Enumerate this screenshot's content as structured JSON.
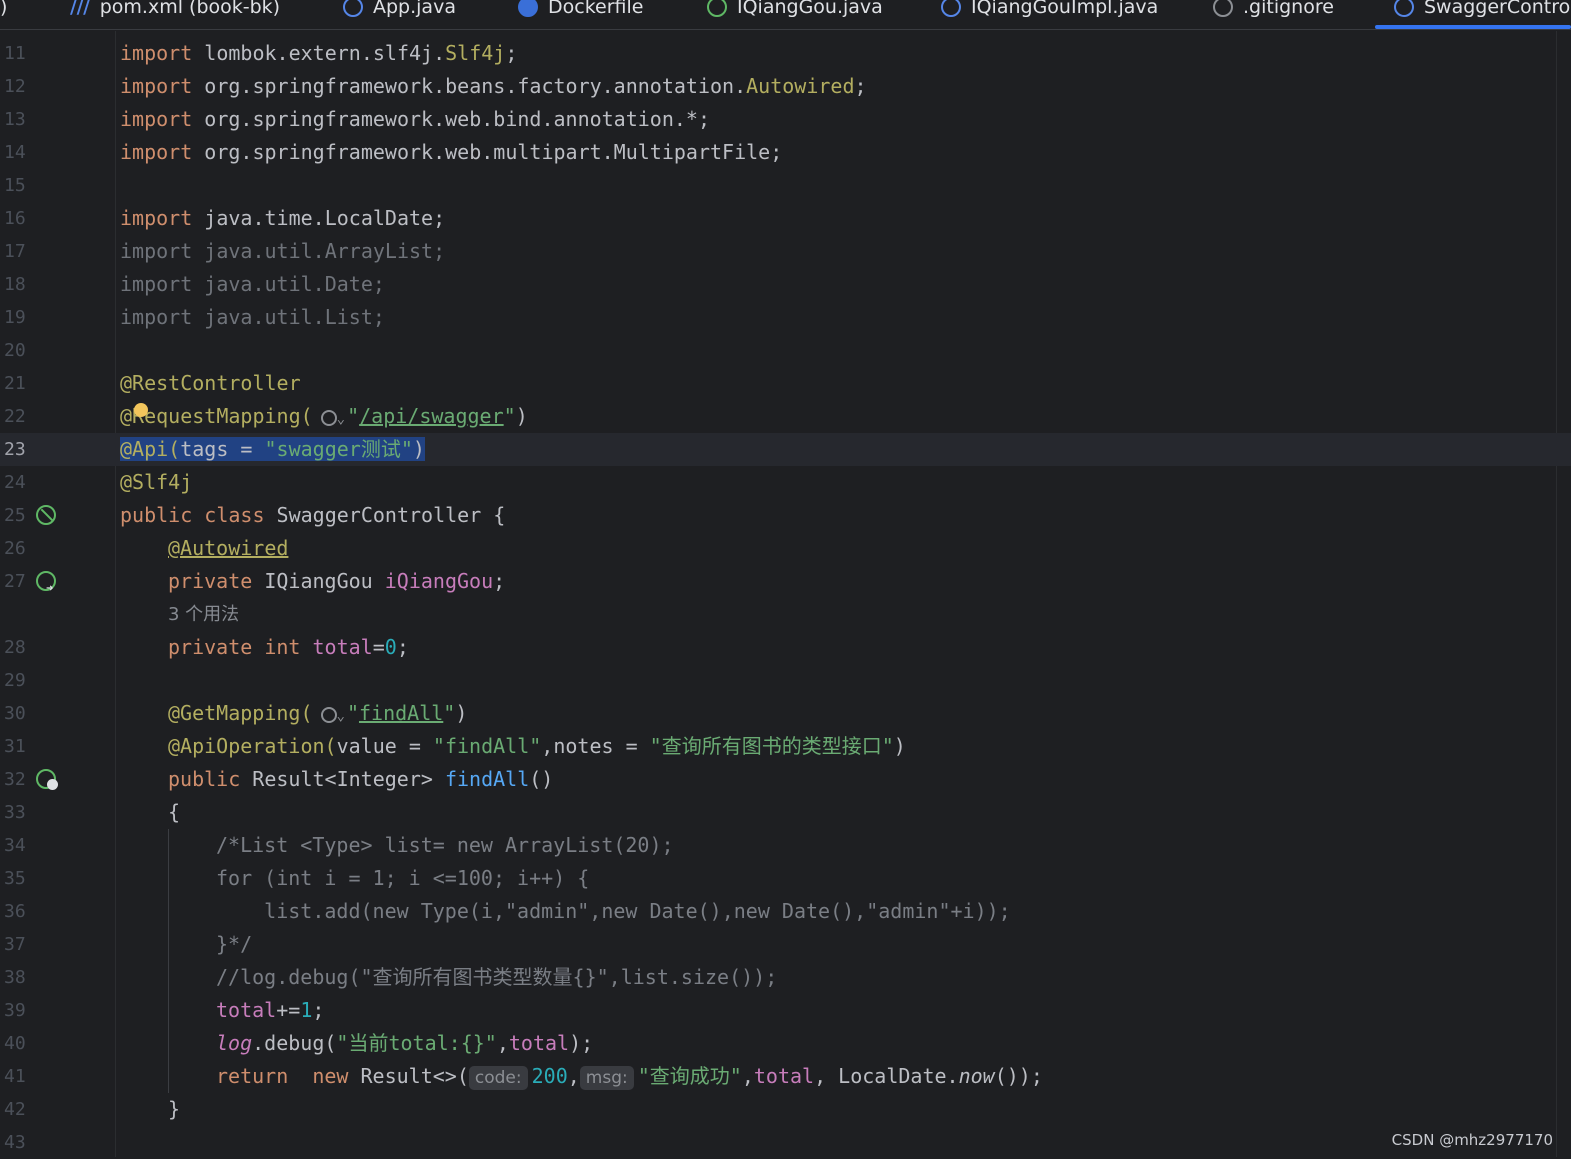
{
  "tabs": [
    {
      "label": "pom.xml (book-bk)",
      "icon": "xml-icon"
    },
    {
      "label": "App.java",
      "icon": "java-class-icon"
    },
    {
      "label": "Dockerfile",
      "icon": "docker-icon"
    },
    {
      "label": "IQiangGou.java",
      "icon": "java-interface-icon"
    },
    {
      "label": "IQiangGouImpl.java",
      "icon": "java-class-icon"
    },
    {
      "label": ".gitignore",
      "icon": "gitignore-icon"
    },
    {
      "label": "SwaggerContro",
      "icon": "java-class-icon",
      "active": true
    }
  ],
  "editor": {
    "current_line": 23,
    "line_numbers": [
      "11",
      "12",
      "13",
      "14",
      "15",
      "16",
      "17",
      "18",
      "19",
      "20",
      "21",
      "22",
      "23",
      "24",
      "25",
      "26",
      "27",
      "",
      "28",
      "29",
      "30",
      "31",
      "32",
      "33",
      "34",
      "35",
      "36",
      "37",
      "38",
      "39",
      "40",
      "41",
      "42",
      "43"
    ],
    "usage_hint": "3 个用法",
    "code": {
      "l11_kw": "import",
      "l11_pkg": " lombok.extern.slf4j.",
      "l11_cls": "Slf4j",
      "l11_end": ";",
      "l12_kw": "import",
      "l12_pkg": " org.springframework.beans.factory.annotation.",
      "l12_cls": "Autowired",
      "l12_end": ";",
      "l13_kw": "import",
      "l13_rest": " org.springframework.web.bind.annotation.*;",
      "l14_kw": "import",
      "l14_rest": " org.springframework.web.multipart.MultipartFile;",
      "l16_kw": "import",
      "l16_rest": " java.time.LocalDate;",
      "l17": "import java.util.ArrayList;",
      "l18": "import java.util.Date;",
      "l19": "import java.util.List;",
      "l21": "@RestController",
      "l22_ann": "@RequestMapping(",
      "l22_str_q1": "\"",
      "l22_path": "/api/swagger",
      "l22_str_q2": "\"",
      "l22_end": ")",
      "l23_ann": "@Api(",
      "l23_mid": "tags = ",
      "l23_str": "\"swagger测试\"",
      "l23_end": ")",
      "l24": "@Slf4j",
      "l25_kw": "public class",
      "l25_rest": " SwaggerController {",
      "l26": "@Autowired",
      "l27_kw": "private",
      "l27_type": " IQiangGou ",
      "l27_fld": "iQiangGou",
      "l27_end": ";",
      "l28_kw": "private int",
      "l28_sp": " ",
      "l28_fld": "total",
      "l28_eq": "=",
      "l28_num": "0",
      "l28_end": ";",
      "l30_ann": "@GetMapping(",
      "l30_q1": "\"",
      "l30_path": "findAll",
      "l30_q2": "\"",
      "l30_end": ")",
      "l31_ann": "@ApiOperation(",
      "l31_a": "value = ",
      "l31_s1": "\"findAll\"",
      "l31_b": ",notes = ",
      "l31_s2": "\"查询所有图书的类型接口\"",
      "l31_end": ")",
      "l32_kw": "public",
      "l32_type": " Result<Integer> ",
      "l32_fn": "findAll",
      "l32_end": "()",
      "l33": "{",
      "l34": "/*List <Type> list= new ArrayList(20);",
      "l35": "for (int i = 1; i <=100; i++) {",
      "l36": "    list.add(new Type(i,\"admin\",new Date(),new Date(),\"admin\"+i));",
      "l37": "}*/",
      "l38": "//log.debug(\"查询所有图书类型数量{}\",list.size());",
      "l39_fld": "total",
      "l39_op": "+=",
      "l39_num": "1",
      "l39_end": ";",
      "l40_log": "log",
      "l40_a": ".debug(",
      "l40_str": "\"当前total:{}\"",
      "l40_b": ",",
      "l40_fld": "total",
      "l40_end": ");",
      "l41_kw": "return",
      "l41_sp": "  ",
      "l41_new": "new",
      "l41_a": " Result<>(",
      "l41_hint1": "code:",
      "l41_num": "200",
      "l41_b": ",",
      "l41_hint2": "msg:",
      "l41_str": "\"查询成功\"",
      "l41_c": ",",
      "l41_fld": "total",
      "l41_d": ", LocalDate.",
      "l41_now": "now",
      "l41_end": "());",
      "l42": "}"
    }
  },
  "watermark": "CSDN @mhz2977170",
  "colors": {
    "background": "#1e1f22",
    "keyword": "#cf8e6d",
    "annotation": "#b3ae60",
    "string": "#6aab73",
    "number": "#2aacb8",
    "field": "#c77dbb",
    "selection": "#214283"
  }
}
